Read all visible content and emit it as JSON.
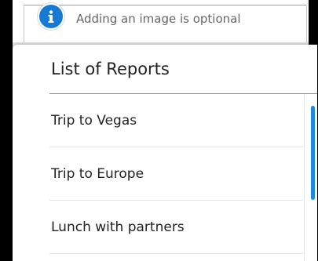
{
  "banner": {
    "icon": "info-icon",
    "text": "Adding an image is optional",
    "accent_color": "#1679d4"
  },
  "dialog": {
    "title": "List of Reports",
    "items": [
      {
        "label": "Trip to Vegas"
      },
      {
        "label": "Trip to Europe"
      },
      {
        "label": "Lunch with partners"
      }
    ],
    "accent_color": "#1e88e5"
  }
}
